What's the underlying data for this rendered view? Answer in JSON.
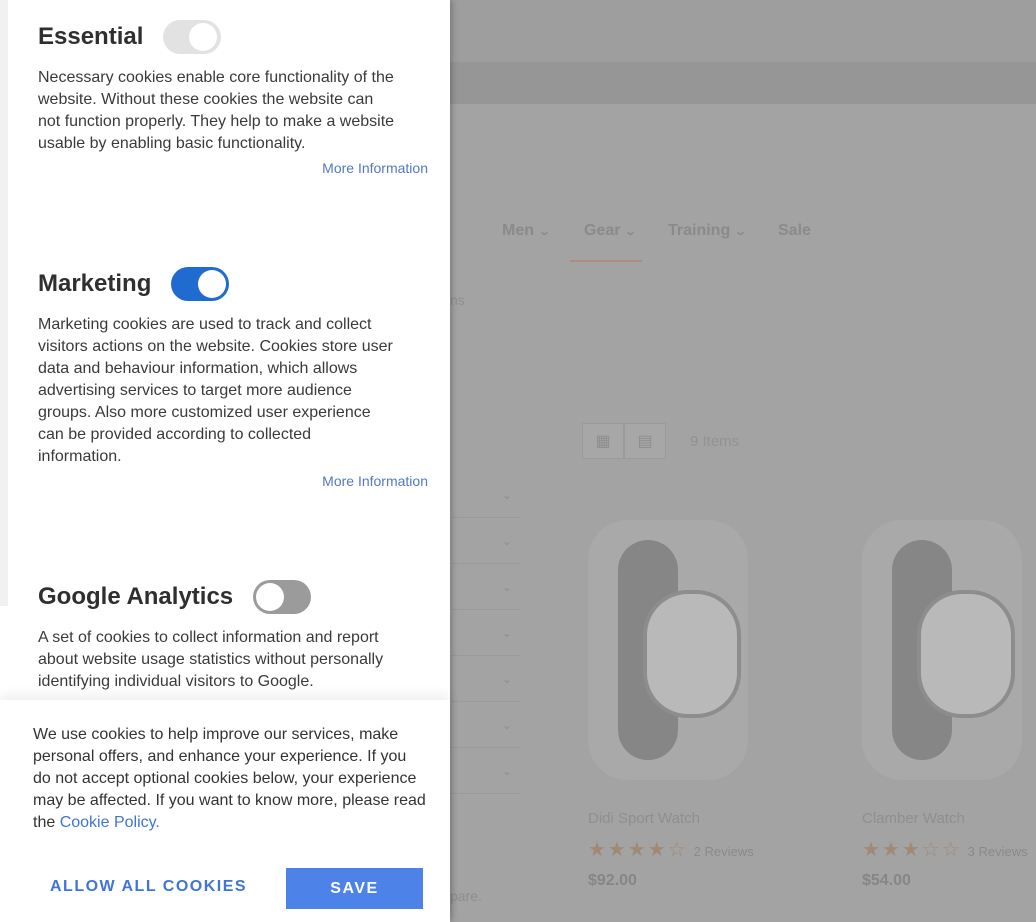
{
  "background": {
    "nav": [
      {
        "label": "Men"
      },
      {
        "label": "Gear"
      },
      {
        "label": "Training"
      },
      {
        "label": "Sale"
      }
    ],
    "breadcrumb": "ns",
    "item_count": "9 Items",
    "products": [
      {
        "name": "Didi Sport Watch",
        "rating_stars": 3.5,
        "reviews": "2 Reviews",
        "price": "$92.00"
      },
      {
        "name": "Clamber Watch",
        "rating_stars": 3,
        "reviews": "3 Reviews",
        "price": "$54.00"
      }
    ],
    "compare_text": "pare."
  },
  "cookie_panel": {
    "sections": [
      {
        "title": "Essential",
        "toggle_state": "disabled-on",
        "text": "Necessary cookies enable core functionality of the website. Without these cookies the website can not function properly. They help to make a website usable by enabling basic functionality.",
        "more_link": "More Information"
      },
      {
        "title": "Marketing",
        "toggle_state": "on",
        "text": "Marketing cookies are used to track and collect visitors actions on the website. Cookies store user data and behaviour information, which allows advertising services to target more audience groups. Also more customized user experience can be provided according to collected information.",
        "more_link": "More Information"
      },
      {
        "title": "Google Analytics",
        "toggle_state": "off",
        "text": "A set of cookies to collect information and report about website usage statistics without personally identifying individual visitors to Google."
      }
    ],
    "intro_text": "We use cookies to help improve our services, make personal offers, and enhance your experience. If you do not accept optional cookies below, your experience may be affected. If you want to know more, please read the ",
    "policy_link": "Cookie Policy.",
    "allow_all_label": "ALLOW ALL COOKIES",
    "save_label": "SAVE",
    "colors": {
      "accent": "#1f6bcf",
      "link": "#3f74d8",
      "save_button": "#4d83e8"
    }
  }
}
